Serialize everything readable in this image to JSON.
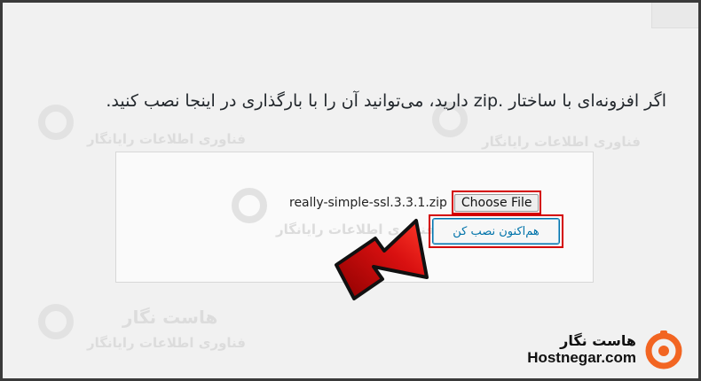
{
  "intro_text": "اگر افزونه‌ای با ساختار .zip دارید، می‌توانید آن را با بارگذاری در اینجا نصب کنید.",
  "upload": {
    "file_name": "really-simple-ssl.3.3.1.zip",
    "choose_file_label": "Choose File",
    "install_label": "هم‌اکنون نصب کن"
  },
  "watermark": {
    "name": "هاست نگار",
    "subtitle": "فناوری اطلاعات رایانگار"
  },
  "brand": {
    "name_fa": "هاست نگار",
    "name_en": "Hostnegar.com",
    "accent": "#f26522"
  },
  "icons": {
    "arrow": "red-arrow-icon",
    "logo": "hostnegar-logo-icon"
  }
}
